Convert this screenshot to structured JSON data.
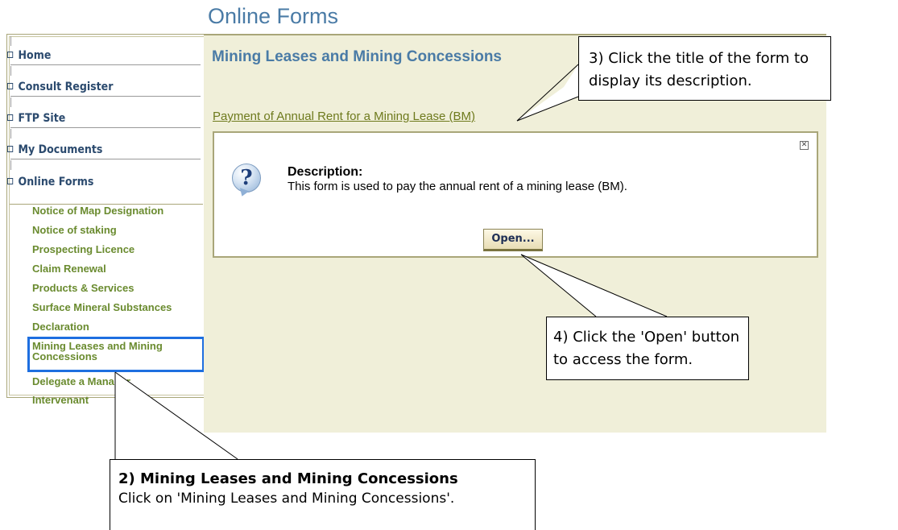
{
  "page_title": "Online Forms",
  "sidebar": {
    "main_items": [
      {
        "label": "Home"
      },
      {
        "label": "Consult Register"
      },
      {
        "label": "FTP Site"
      },
      {
        "label": "My Documents"
      },
      {
        "label": "Online Forms"
      }
    ],
    "sub_items": [
      {
        "label": "Notice of Map Designation"
      },
      {
        "label": "Notice of staking"
      },
      {
        "label": "Prospecting Licence"
      },
      {
        "label": "Claim Renewal"
      },
      {
        "label": "Products & Services"
      },
      {
        "label": "Surface Mineral Substances"
      },
      {
        "label": "Declaration"
      },
      {
        "label": "Mining Leases and Mining Concessions",
        "selected": true
      },
      {
        "label": "Delegate a Manager"
      },
      {
        "label": "Intervenant"
      }
    ]
  },
  "main": {
    "section_title": "Mining Leases and Mining Concessions",
    "form_link": "Payment of Annual Rent for a Mining Lease (BM)",
    "description_label": "Description:",
    "description_text": "This form is used to pay the annual rent of a mining lease (BM).",
    "open_button": "Open..."
  },
  "callouts": {
    "step3": "3) Click the title of the form to display its description.",
    "step4": "4) Click the 'Open' button to access the form.",
    "step2_title": "2) Mining Leases and Mining Concessions",
    "step2_text": "Click on 'Mining Leases and Mining Concessions'."
  },
  "colors": {
    "accent_title": "#4a7ba6",
    "link": "#6e7a1d",
    "sub_item": "#6a8b2f",
    "panel_bg": "#f0efd9",
    "selection_highlight": "#1e6fe0"
  },
  "icons": [
    "question-icon",
    "close-icon",
    "bullet-icon"
  ]
}
